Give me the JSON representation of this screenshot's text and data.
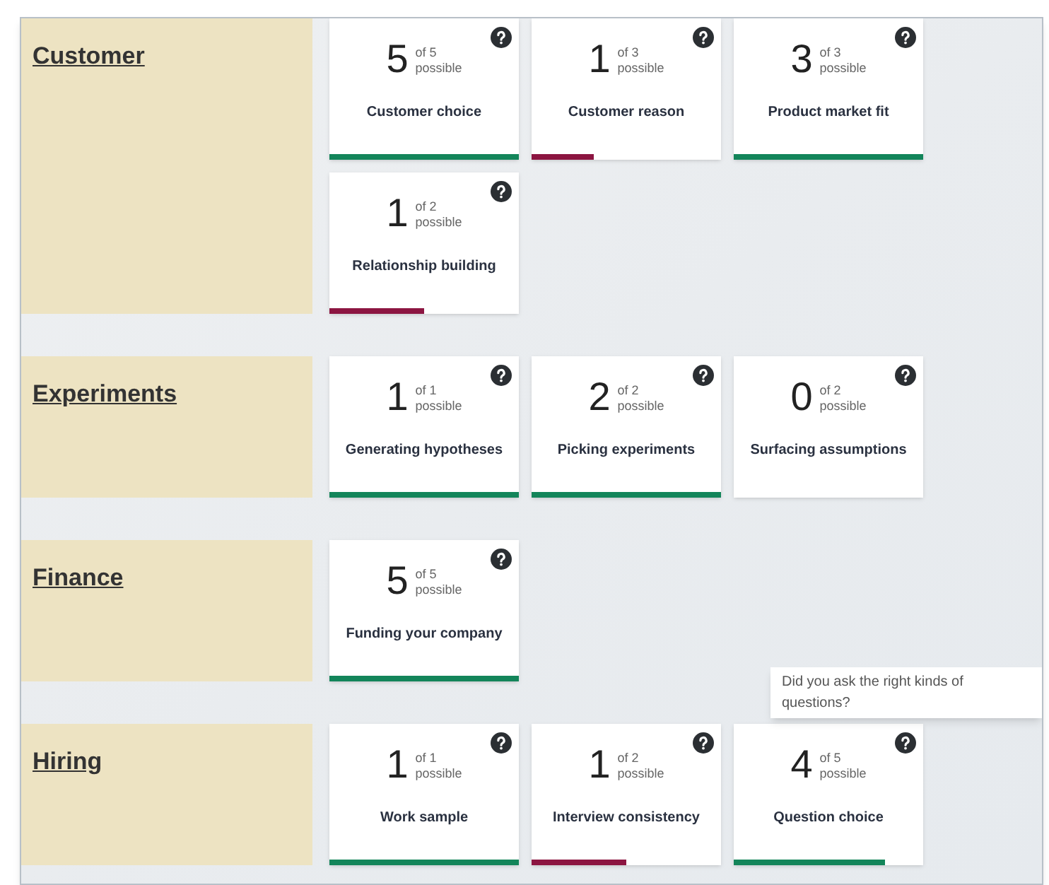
{
  "sections": [
    {
      "title": "Customer",
      "cards": [
        {
          "score": "5",
          "of": "of 5",
          "possible": "possible",
          "title": "Customer choice",
          "level": 1,
          "color": "#13855a"
        },
        {
          "score": "1",
          "of": "of 3",
          "possible": "possible",
          "title": "Customer reason",
          "level": 0.33,
          "color": "#8c1541"
        },
        {
          "score": "3",
          "of": "of 3",
          "possible": "possible",
          "title": "Product market fit",
          "level": 1,
          "color": "#13855a"
        },
        {
          "score": "1",
          "of": "of 2",
          "possible": "possible",
          "title": "Relationship building",
          "level": 0.5,
          "color": "#8c1541"
        }
      ]
    },
    {
      "title": "Experiments",
      "cards": [
        {
          "score": "1",
          "of": "of 1",
          "possible": "possible",
          "title": "Generating hypotheses",
          "level": 1,
          "color": "#13855a"
        },
        {
          "score": "2",
          "of": "of 2",
          "possible": "possible",
          "title": "Picking experiments",
          "level": 1,
          "color": "#13855a"
        },
        {
          "score": "0",
          "of": "of 2",
          "possible": "possible",
          "title": "Surfacing assumptions"
        }
      ]
    },
    {
      "title": "Finance",
      "cards": [
        {
          "score": "5",
          "of": "of 5",
          "possible": "possible",
          "title": "Funding your company",
          "level": 1,
          "color": "#13855a"
        }
      ]
    },
    {
      "title": "Hiring",
      "cards": [
        {
          "score": "1",
          "of": "of 1",
          "possible": "possible",
          "title": "Work sample",
          "level": 1,
          "color": "#13855a"
        },
        {
          "score": "1",
          "of": "of 2",
          "possible": "possible",
          "title": "Interview consistency",
          "level": 0.5,
          "color": "#8c1541"
        },
        {
          "score": "4",
          "of": "of 5",
          "possible": "possible",
          "title": "Question choice",
          "level": 0.8,
          "color": "#13855a",
          "tooltip": "Did you ask the right kinds of questions?"
        }
      ]
    }
  ]
}
